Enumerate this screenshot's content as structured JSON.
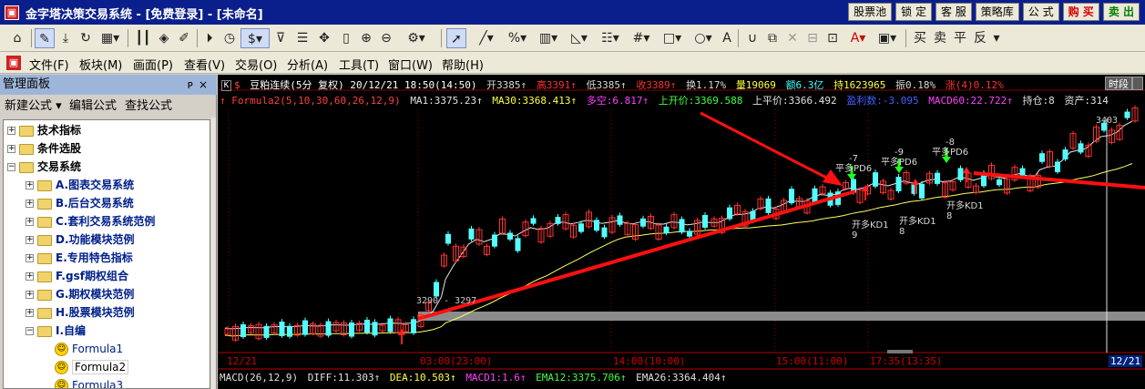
{
  "titlebar": {
    "title": "金字塔决策交易系统 - [免费登录] - [未命名]",
    "buttons": [
      {
        "label": "股票池",
        "kind": "normal"
      },
      {
        "label": "锁 定",
        "kind": "normal"
      },
      {
        "label": "客 服",
        "kind": "normal"
      },
      {
        "label": "策略库",
        "kind": "normal"
      },
      {
        "label": "公 式",
        "kind": "normal"
      },
      {
        "label": "购 买",
        "kind": "buy"
      },
      {
        "label": "卖 出",
        "kind": "sell"
      }
    ]
  },
  "toolbar": {
    "icons": [
      "home-icon",
      "pencil-icon",
      "download-icon",
      "refresh-icon",
      "grid-icon",
      "bars-icon",
      "diamond-icon",
      "edit-icon",
      "play-icon",
      "dollar-icon",
      "filter-icon",
      "move-icon",
      "column-icon",
      "zoom-in-icon",
      "zoom-out-icon",
      "settings-icon",
      "cursor-icon",
      "line-icon",
      "percent-icon",
      "ruler-icon",
      "triangle-ruler-icon",
      "lines-icon",
      "hash-icon",
      "rectangle-icon",
      "circle-icon",
      "text-icon",
      "magnet-icon",
      "copy-icon",
      "delete-icon",
      "lock-icon",
      "unlock-icon",
      "font-color-icon",
      "save-icon"
    ],
    "glyphs": {
      "dollar": "$",
      "text": "A",
      "font_color": "A"
    },
    "trade_buttons": [
      "买",
      "卖",
      "平",
      "反"
    ]
  },
  "menu": {
    "items": [
      "文件(F)",
      "板块(M)",
      "画面(P)",
      "查看(V)",
      "交易(O)",
      "分析(A)",
      "工具(T)",
      "窗口(W)",
      "帮助(H)"
    ]
  },
  "panel": {
    "title": "管理面板",
    "pin": "ᴘ",
    "close": "×",
    "actions": [
      "新建公式 ▾",
      "编辑公式",
      "查找公式"
    ],
    "tree": [
      {
        "label": "技术指标",
        "level": 1,
        "expanded": false
      },
      {
        "label": "条件选股",
        "level": 1,
        "expanded": false
      },
      {
        "label": "交易系统",
        "level": 1,
        "expanded": true
      },
      {
        "label": "A.图表交易系统",
        "level": 2,
        "expanded": false
      },
      {
        "label": "B.后台交易系统",
        "level": 2,
        "expanded": false
      },
      {
        "label": "C.套利交易系统范例",
        "level": 2,
        "expanded": false
      },
      {
        "label": "D.功能模块范例",
        "level": 2,
        "expanded": false
      },
      {
        "label": "E.专用特色指标",
        "level": 2,
        "expanded": false
      },
      {
        "label": "F.gsf期权组合",
        "level": 2,
        "expanded": false
      },
      {
        "label": "G.期权模块范例",
        "level": 2,
        "expanded": false
      },
      {
        "label": "H.股票模块范例",
        "level": 2,
        "expanded": false
      },
      {
        "label": "I.自编",
        "level": 2,
        "expanded": true
      },
      {
        "label": "Formula1",
        "level": 3,
        "selected": false
      },
      {
        "label": "Formula2",
        "level": 3,
        "selected": true
      },
      {
        "label": "Formula3",
        "level": 3,
        "selected": false
      }
    ]
  },
  "chart": {
    "header1": [
      {
        "text": "$",
        "color": "#ff4040"
      },
      {
        "text": "豆粕连续(5分 复权) 20/12/21 18:50(14:50)",
        "color": "#ffffff"
      },
      {
        "text": "开3385↑",
        "color": "#d8d8d8"
      },
      {
        "text": "高3391↑",
        "color": "#ff3030"
      },
      {
        "text": "低3385↑",
        "color": "#d8d8d8"
      },
      {
        "text": "收3389↑",
        "color": "#ff3030"
      },
      {
        "text": "换1.17%",
        "color": "#d8d8d8"
      },
      {
        "text": "量19069",
        "color": "#ffff40"
      },
      {
        "text": "额6.3亿",
        "color": "#40ffff"
      },
      {
        "text": "持1623965",
        "color": "#ffff40"
      },
      {
        "text": "振0.18%",
        "color": "#d8d8d8"
      },
      {
        "text": "涨(4)0.12%",
        "color": "#ff3030"
      }
    ],
    "header2": [
      {
        "text": "↑ Formula2(5,10,30,60,26,12,9)",
        "color": "#e0e0e0"
      },
      {
        "text": "MA1:3375.23↑",
        "color": "#e0e0e0"
      },
      {
        "text": "MA30:3368.413↑",
        "color": "#ffff40"
      },
      {
        "text": "多空:6.817↑",
        "color": "#ff40ff"
      },
      {
        "text": "上开价:3369.588",
        "color": "#40ff40"
      },
      {
        "text": "上平价:3366.492",
        "color": "#e0e0e0"
      },
      {
        "text": "盈利数:-3.095",
        "color": "#4060ff"
      },
      {
        "text": "MACD60:22.722↑",
        "color": "#ff40ff"
      },
      {
        "text": "持仓:8",
        "color": "#e0e0e0"
      },
      {
        "text": "资产:314",
        "color": "#e0e0e0"
      }
    ],
    "k_label": "K",
    "timeshare_label": "时段",
    "range_label": "3290 - 3297",
    "high_label": "3403",
    "date_axis": [
      {
        "text": "12/21",
        "current": false
      },
      {
        "text": "03:00(23:00)",
        "current": false
      },
      {
        "text": "14:00(10:00)",
        "current": false
      },
      {
        "text": "15:00(11:00)",
        "current": false
      },
      {
        "text": "17:35(13:35)",
        "current": false
      },
      {
        "text": "12/21",
        "current": true
      }
    ],
    "signals": [
      {
        "top": "-7",
        "label": "平多PD6",
        "kind": "sell"
      },
      {
        "top": "-9",
        "label": "平多PD6",
        "kind": "sell"
      },
      {
        "top": "-8",
        "label": "平多PD6",
        "kind": "sell"
      },
      {
        "label": "开多KD1",
        "value": "9",
        "kind": "buy"
      },
      {
        "label": "开多KD1",
        "value": "8",
        "kind": "buy"
      },
      {
        "label": "开多KD1",
        "value": "8",
        "kind": "buy"
      }
    ],
    "macd": [
      {
        "text": "MACD(26,12,9)",
        "color": "#e0e0e0"
      },
      {
        "text": "DIFF:11.303↑",
        "color": "#e0e0e0"
      },
      {
        "text": "DEA:10.503↑",
        "color": "#ffff40"
      },
      {
        "text": "MACD1:1.6↑",
        "color": "#ff40ff"
      },
      {
        "text": "EMA12:3375.706↑",
        "color": "#40ff40"
      },
      {
        "text": "EMA26:3364.404↑",
        "color": "#e0e0e0"
      }
    ]
  },
  "colors": {
    "up": "#ff3030",
    "down": "#54ffff",
    "ma1": "#e8e8e8",
    "ma30": "#ffff60",
    "annotation": "#ff1010",
    "signal_sell": "#20ff20",
    "signal_buy": "#ff2020"
  }
}
